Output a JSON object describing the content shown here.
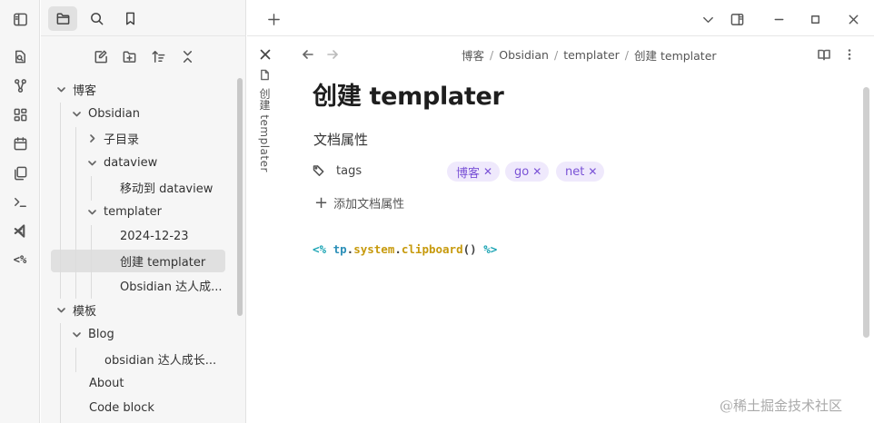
{
  "ribbon": {
    "icons": [
      "open-quick-switcher-icon",
      "graph-view-icon",
      "canvas-icon",
      "calendar-icon",
      "templates-icon",
      "terminal-icon",
      "vscode-icon",
      "templater-icon"
    ],
    "templater_glyph": "<%"
  },
  "sidebar": {
    "tabs": [
      "file-explorer",
      "search",
      "bookmarks"
    ],
    "actions": [
      "new-note",
      "new-folder",
      "change-sort-order",
      "collapse-all"
    ],
    "tree": [
      {
        "label": "博客",
        "depth": 0,
        "type": "folder",
        "expanded": true
      },
      {
        "label": "Obsidian",
        "depth": 1,
        "type": "folder",
        "expanded": true
      },
      {
        "label": "子目录",
        "depth": 2,
        "type": "folder",
        "expanded": false
      },
      {
        "label": "dataview",
        "depth": 2,
        "type": "folder",
        "expanded": true
      },
      {
        "label": "移动到 dataview",
        "depth": 3,
        "type": "file"
      },
      {
        "label": "templater",
        "depth": 2,
        "type": "folder",
        "expanded": true
      },
      {
        "label": "2024-12-23",
        "depth": 3,
        "type": "file"
      },
      {
        "label": "创建 templater",
        "depth": 3,
        "type": "file",
        "selected": true
      },
      {
        "label": "Obsidian 达人成...",
        "depth": 3,
        "type": "file"
      },
      {
        "label": "模板",
        "depth": 0,
        "type": "folder",
        "expanded": true
      },
      {
        "label": "Blog",
        "depth": 1,
        "type": "folder",
        "expanded": true
      },
      {
        "label": "obsidian 达人成长...",
        "depth": 2,
        "type": "file"
      },
      {
        "label": "About",
        "depth": 1,
        "type": "file"
      },
      {
        "label": "Code block",
        "depth": 1,
        "type": "file"
      }
    ]
  },
  "stack": {
    "vertical_title": "创建 templater"
  },
  "breadcrumb": [
    "博客",
    "Obsidian",
    "templater",
    "创建 templater"
  ],
  "breadcrumb_sep": "/",
  "note": {
    "title": "创建 templater",
    "properties_heading": "文档属性",
    "property_key": "tags",
    "tags": [
      "博客",
      "go",
      "net"
    ],
    "add_property": "添加文档属性",
    "code": {
      "open": "<%",
      "obj": "tp",
      "dot1": ".",
      "mod": "system",
      "dot2": ".",
      "fn": "clipboard",
      "parens": "()",
      "close": "%>"
    }
  },
  "watermark": "@稀土掘金技术社区",
  "colors": {
    "accent": "#7a52d6",
    "tag_bg": "#efe9fc",
    "code_delim": "#18a3b3",
    "code_func": "#c79a0d"
  }
}
